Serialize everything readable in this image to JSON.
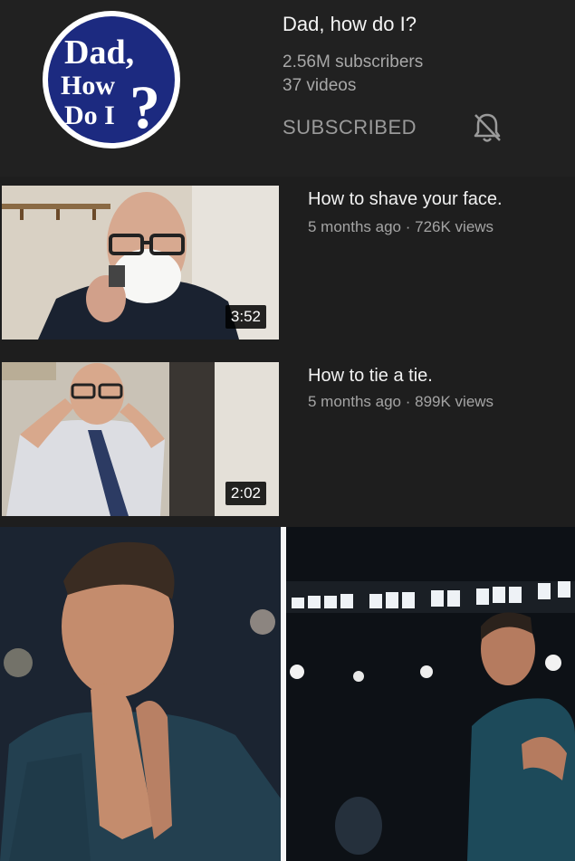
{
  "channel": {
    "logo_text": [
      "Dad,",
      "How",
      "Do I",
      "?"
    ],
    "title": "Dad, how do I?",
    "subscribers": "2.56M subscribers",
    "videos_count": "37 videos",
    "subscribe_state": "SUBSCRIBED",
    "bell_icon": "bell-off-icon"
  },
  "videos": [
    {
      "title": "How to shave your face.",
      "meta": "5 months ago · 726K views",
      "duration": "3:52"
    },
    {
      "title": "How to tie a tie.",
      "meta": "5 months ago · 899K views",
      "duration": "2:02"
    }
  ],
  "colors": {
    "background": "#1e1e1e",
    "logo_blue": "#1c2a80",
    "meta_text": "#a4a4a4"
  }
}
